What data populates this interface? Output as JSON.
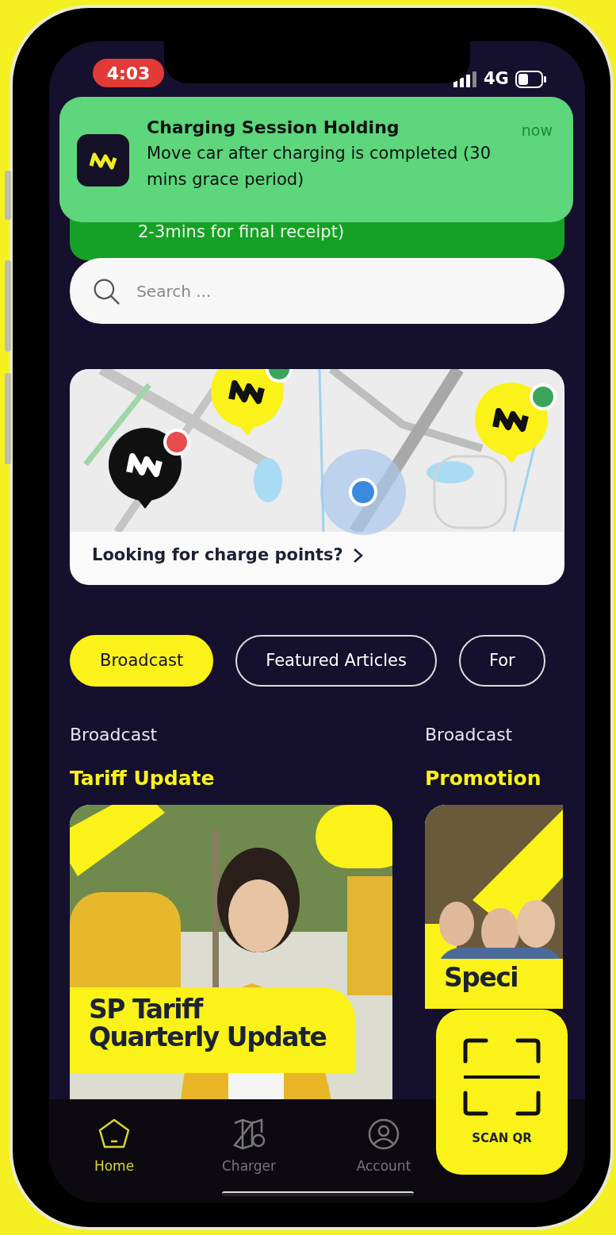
{
  "status_bar": {
    "time": "4:03",
    "network": "4G"
  },
  "notification": {
    "title": "Charging Session Holding",
    "time": "now",
    "message": "Move car after charging is completed (30 mins grace period)"
  },
  "banner": {
    "text": "2-3mins for final receipt)"
  },
  "search": {
    "placeholder": "Search ..."
  },
  "map_card": {
    "link": "Looking for charge points?",
    "pins": [
      {
        "kind": "dark",
        "color": "#e84c4c"
      },
      {
        "kind": "yellow",
        "color": "#3aa55a"
      },
      {
        "kind": "yellow",
        "color": "#3aa55a"
      }
    ]
  },
  "tabs": [
    {
      "label": "Broadcast",
      "selected": true
    },
    {
      "label": "Featured Articles",
      "selected": false
    },
    {
      "label": "For",
      "selected": false
    }
  ],
  "articles": [
    {
      "category": "Broadcast",
      "title": "Tariff Update",
      "banner": "SP Tariff Quarterly Update"
    },
    {
      "category": "Broadcast",
      "title": "Promotion",
      "banner": "Speci"
    }
  ],
  "nav": [
    {
      "label": "Home",
      "selected": true
    },
    {
      "label": "Charger",
      "selected": false
    },
    {
      "label": "Account",
      "selected": false
    }
  ],
  "scan_button": {
    "label": "SCAN QR"
  }
}
